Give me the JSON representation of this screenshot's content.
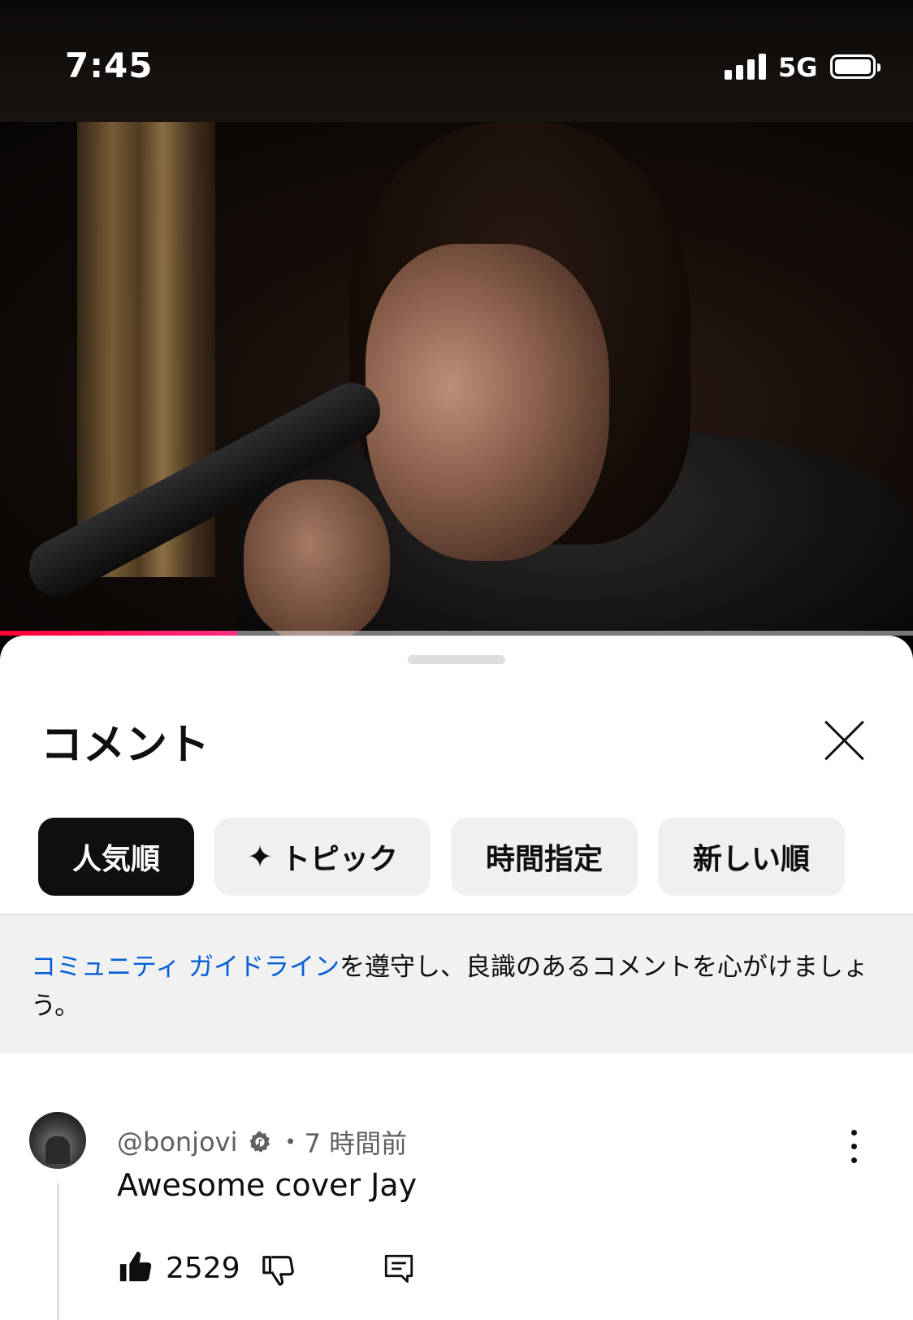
{
  "status_bar": {
    "time": "7:45",
    "network": "5G"
  },
  "video": {
    "progress_fraction": 0.26,
    "progress_color": "#ff0033"
  },
  "sheet": {
    "title": "コメント",
    "close_icon": "close-icon"
  },
  "chips": [
    {
      "label": "人気順",
      "active": true
    },
    {
      "label": "トピック",
      "icon": "sparkle-icon",
      "active": false
    },
    {
      "label": "時間指定",
      "active": false
    },
    {
      "label": "新しい順",
      "active": false
    }
  ],
  "notice": {
    "link_text": "コミュニティ ガイドライン",
    "text": "を遵守し、良識のあるコメントを心がけましょう。"
  },
  "comments": [
    {
      "author": "@bonjovi",
      "verified": true,
      "separator": "•",
      "time": "7 時間前",
      "text": "Awesome cover Jay",
      "likes": "2529"
    }
  ],
  "colors": {
    "link": "#065fd4",
    "chip_active_bg": "#0f0f0f",
    "chip_bg": "#f0f0f0"
  }
}
